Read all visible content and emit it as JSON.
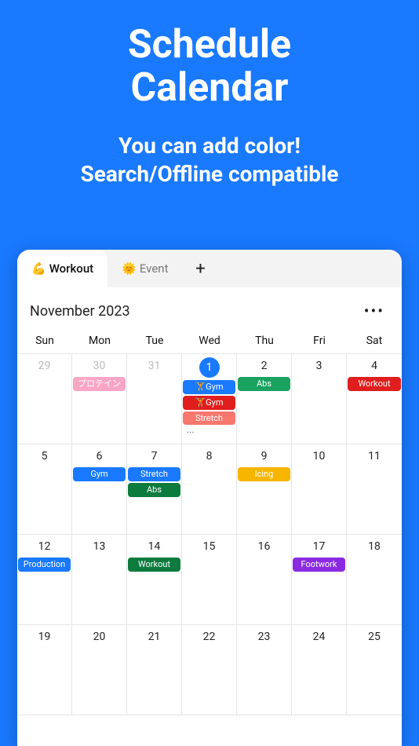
{
  "hero": {
    "title_line1": "Schedule",
    "title_line2": "Calendar",
    "sub_line1": "You can add color!",
    "sub_line2": "Search/Offline compatible"
  },
  "tabs": {
    "items": [
      {
        "emoji": "💪",
        "label": "Workout",
        "active": true
      },
      {
        "emoji": "🌞",
        "label": "Event",
        "active": false
      }
    ],
    "add": "+"
  },
  "month": {
    "label": "November 2023",
    "more": "•••"
  },
  "weekdays": [
    "Sun",
    "Mon",
    "Tue",
    "Wed",
    "Thu",
    "Fri",
    "Sat"
  ],
  "colors": {
    "blue": "#1979ff",
    "green": "#1aa260",
    "red": "#e01e1e",
    "salmon": "#f7776f",
    "pink": "#f9a6c4",
    "amber": "#f7b500",
    "darkgreen": "#0d7a3e",
    "purple": "#8a2be2"
  },
  "cells": [
    {
      "day": "29",
      "grey": true,
      "today": false,
      "events": [],
      "overflow": false
    },
    {
      "day": "30",
      "grey": true,
      "today": false,
      "events": [
        {
          "label": "プロテイン",
          "color": "pink"
        }
      ],
      "overflow": false
    },
    {
      "day": "31",
      "grey": true,
      "today": false,
      "events": [],
      "overflow": false
    },
    {
      "day": "1",
      "grey": false,
      "today": true,
      "events": [
        {
          "label": "🏋️Gym",
          "color": "blue"
        },
        {
          "label": "🏋️Gym",
          "color": "red"
        },
        {
          "label": "Stretch",
          "color": "salmon"
        }
      ],
      "overflow": true
    },
    {
      "day": "2",
      "grey": false,
      "today": false,
      "events": [
        {
          "label": "Abs",
          "color": "green"
        }
      ],
      "overflow": false
    },
    {
      "day": "3",
      "grey": false,
      "today": false,
      "events": [],
      "overflow": false
    },
    {
      "day": "4",
      "grey": false,
      "today": false,
      "events": [
        {
          "label": "Workout",
          "color": "red"
        }
      ],
      "overflow": false
    },
    {
      "day": "5",
      "grey": false,
      "today": false,
      "events": [],
      "overflow": false
    },
    {
      "day": "6",
      "grey": false,
      "today": false,
      "events": [
        {
          "label": "Gym",
          "color": "blue"
        }
      ],
      "overflow": false
    },
    {
      "day": "7",
      "grey": false,
      "today": false,
      "events": [
        {
          "label": "Stretch",
          "color": "blue"
        },
        {
          "label": "Abs",
          "color": "darkgreen"
        }
      ],
      "overflow": false
    },
    {
      "day": "8",
      "grey": false,
      "today": false,
      "events": [],
      "overflow": false
    },
    {
      "day": "9",
      "grey": false,
      "today": false,
      "events": [
        {
          "label": "Icing",
          "color": "amber"
        }
      ],
      "overflow": false
    },
    {
      "day": "10",
      "grey": false,
      "today": false,
      "events": [],
      "overflow": false
    },
    {
      "day": "11",
      "grey": false,
      "today": false,
      "events": [],
      "overflow": false
    },
    {
      "day": "12",
      "grey": false,
      "today": false,
      "events": [
        {
          "label": "Production",
          "color": "blue"
        }
      ],
      "overflow": false
    },
    {
      "day": "13",
      "grey": false,
      "today": false,
      "events": [],
      "overflow": false
    },
    {
      "day": "14",
      "grey": false,
      "today": false,
      "events": [
        {
          "label": "Workout",
          "color": "darkgreen"
        }
      ],
      "overflow": false
    },
    {
      "day": "15",
      "grey": false,
      "today": false,
      "events": [],
      "overflow": false
    },
    {
      "day": "16",
      "grey": false,
      "today": false,
      "events": [],
      "overflow": false
    },
    {
      "day": "17",
      "grey": false,
      "today": false,
      "events": [
        {
          "label": "Footwork",
          "color": "purple"
        }
      ],
      "overflow": false
    },
    {
      "day": "18",
      "grey": false,
      "today": false,
      "events": [],
      "overflow": false
    },
    {
      "day": "19",
      "grey": false,
      "today": false,
      "events": [],
      "overflow": false
    },
    {
      "day": "20",
      "grey": false,
      "today": false,
      "events": [],
      "overflow": false
    },
    {
      "day": "21",
      "grey": false,
      "today": false,
      "events": [],
      "overflow": false
    },
    {
      "day": "22",
      "grey": false,
      "today": false,
      "events": [],
      "overflow": false
    },
    {
      "day": "23",
      "grey": false,
      "today": false,
      "events": [],
      "overflow": false
    },
    {
      "day": "24",
      "grey": false,
      "today": false,
      "events": [],
      "overflow": false
    },
    {
      "day": "25",
      "grey": false,
      "today": false,
      "events": [],
      "overflow": false
    }
  ]
}
